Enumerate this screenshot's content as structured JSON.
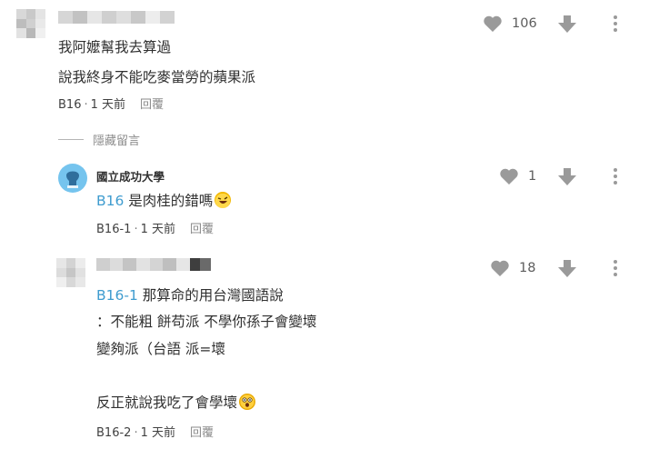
{
  "colors": {
    "mention": "#3f9ccf",
    "icon_gray": "#9a9a9a",
    "text": "#303030",
    "muted": "#8a8a8a",
    "avatar_blue": "#75c4ee"
  },
  "comments": [
    {
      "author": "",
      "lines": [
        "我阿嬤幫我去算過",
        "說我終身不能吃麥當勞的蘋果派"
      ],
      "floor": "B16",
      "time": "1 天前",
      "reply_label": "回覆",
      "likes": "106",
      "like_icon": "heart-icon",
      "dislike_icon": "arrow-down-icon"
    }
  ],
  "hidden_toggle": {
    "label": "隱藏留言"
  },
  "replies": [
    {
      "author": "國立成功大學",
      "avatar_icon": "university-avatar-icon",
      "mention": "B16",
      "text": " 是肉桂的錯嗎",
      "emoji": "rolling-laughing-emoji",
      "floor": "B16-1",
      "time": "1 天前",
      "reply_label": "回覆",
      "likes": "1"
    },
    {
      "author": "",
      "mention": "B16-1",
      "lines": [
        " 那算命的用台灣國語說",
        "：不能粗 餅苟派 不學你孫子會變壞",
        "變夠派（台語 派=壞",
        "",
        "反正就說我吃了會學壞"
      ],
      "emoji": "shocked-face-emoji",
      "floor": "B16-2",
      "time": "1 天前",
      "reply_label": "回覆",
      "likes": "18"
    }
  ]
}
